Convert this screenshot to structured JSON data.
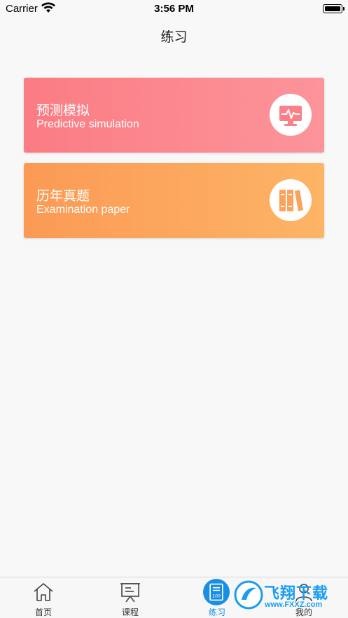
{
  "status_bar": {
    "carrier": "Carrier",
    "time": "3:56 PM"
  },
  "nav": {
    "title": "练习"
  },
  "cards": [
    {
      "title": "预测模拟",
      "subtitle": "Predictive simulation",
      "icon": "monitor-pulse-icon",
      "color": "#fb7c83"
    },
    {
      "title": "历年真题",
      "subtitle": "Examination paper",
      "icon": "books-icon",
      "color": "#fb9a55"
    }
  ],
  "tabs": [
    {
      "label": "首页",
      "icon": "home-icon"
    },
    {
      "label": "课程",
      "icon": "presentation-board-icon"
    },
    {
      "label": "练习",
      "icon": "exam-paper-icon",
      "active": true
    },
    {
      "label": "我的",
      "icon": "profile-icon"
    }
  ],
  "watermark": {
    "text": "飞翔下载",
    "url": "www.FXXZ.com"
  },
  "colors": {
    "accent": "#1a8ee1"
  }
}
